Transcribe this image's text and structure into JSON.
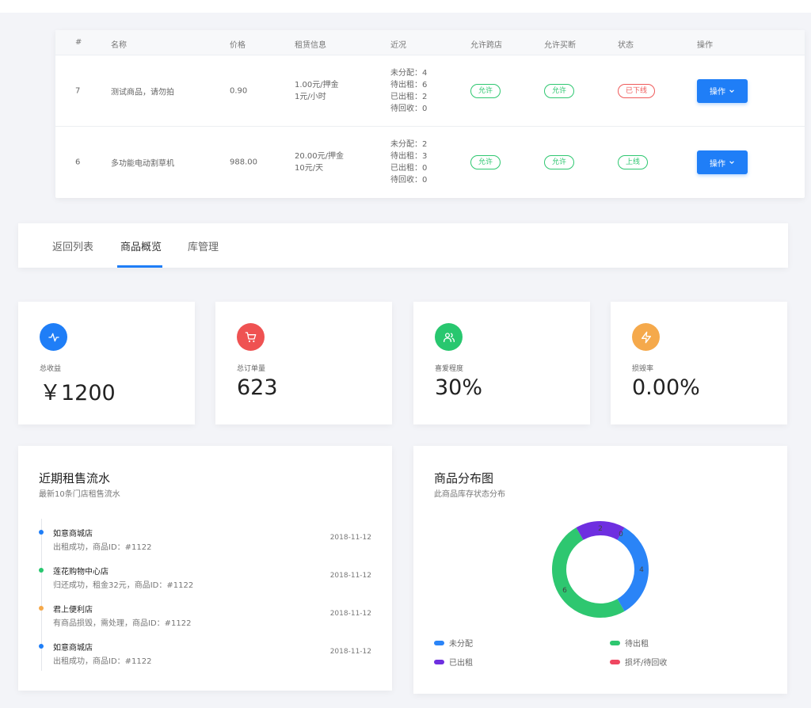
{
  "table": {
    "headers": [
      "#",
      "名称",
      "价格",
      "租赁信息",
      "近况",
      "允许跨店",
      "允许买断",
      "状态",
      "操作"
    ],
    "rows": [
      {
        "id": "7",
        "name": "测试商品，请勿拍",
        "price": "0.90",
        "rent_line1": "1.00元/押金",
        "rent_line2": "1元/小时",
        "recent": [
          "未分配：4",
          "待出租：6",
          "已出租：2",
          "待回收：0"
        ],
        "cross_store": "允许",
        "buyout": "允许",
        "status": "已下线",
        "status_kind": "offline",
        "op_label": "操作"
      },
      {
        "id": "6",
        "name": "多功能电动割草机",
        "price": "988.00",
        "rent_line1": "20.00元/押金",
        "rent_line2": "10元/天",
        "recent": [
          "未分配：2",
          "待出租：3",
          "已出租：0",
          "待回收：0"
        ],
        "cross_store": "允许",
        "buyout": "允许",
        "status": "上线",
        "status_kind": "online",
        "op_label": "操作"
      }
    ]
  },
  "tabs": [
    {
      "label": "返回列表",
      "active": false
    },
    {
      "label": "商品概览",
      "active": true
    },
    {
      "label": "库管理",
      "active": false
    }
  ],
  "stats": [
    {
      "label": "总收益",
      "value": "￥1200",
      "icon": "activity-icon",
      "color": "#1f7ef7"
    },
    {
      "label": "总订单量",
      "value": "623",
      "icon": "cart-icon",
      "color": "#ef5252"
    },
    {
      "label": "喜爱程度",
      "value": "30%",
      "icon": "users-icon",
      "color": "#28c76f"
    },
    {
      "label": "损毁率",
      "value": "0.00%",
      "icon": "lightning-icon",
      "color": "#f5a94b"
    }
  ],
  "timeline": {
    "title": "近期租售流水",
    "subtitle": "最新10条门店租售流水",
    "items": [
      {
        "store": "如意商城店",
        "desc": "出租成功，商品ID：#1122",
        "date": "2018-11-12",
        "color": "#1f7ef7"
      },
      {
        "store": "莲花购物中心店",
        "desc": "归还成功，租金32元，商品ID：#1122",
        "date": "2018-11-12",
        "color": "#28c76f"
      },
      {
        "store": "君上便利店",
        "desc": "有商品损毁，需处理，商品ID：#1122",
        "date": "2018-11-12",
        "color": "#f5a94b"
      },
      {
        "store": "如意商城店",
        "desc": "出租成功，商品ID：#1122",
        "date": "2018-11-12",
        "color": "#1f7ef7"
      }
    ]
  },
  "distribution": {
    "title": "商品分布图",
    "subtitle": "此商品库存状态分布"
  },
  "chart_data": {
    "type": "pie",
    "title": "商品分布图",
    "series": [
      {
        "name": "未分配",
        "value": 4,
        "color": "#2a84f7"
      },
      {
        "name": "待出租",
        "value": 6,
        "color": "#2ec770"
      },
      {
        "name": "已出租",
        "value": 2,
        "color": "#6e2fe0"
      },
      {
        "name": "损坏/待回收",
        "value": 0,
        "color": "#ef4660"
      }
    ],
    "legend_position": "bottom"
  }
}
